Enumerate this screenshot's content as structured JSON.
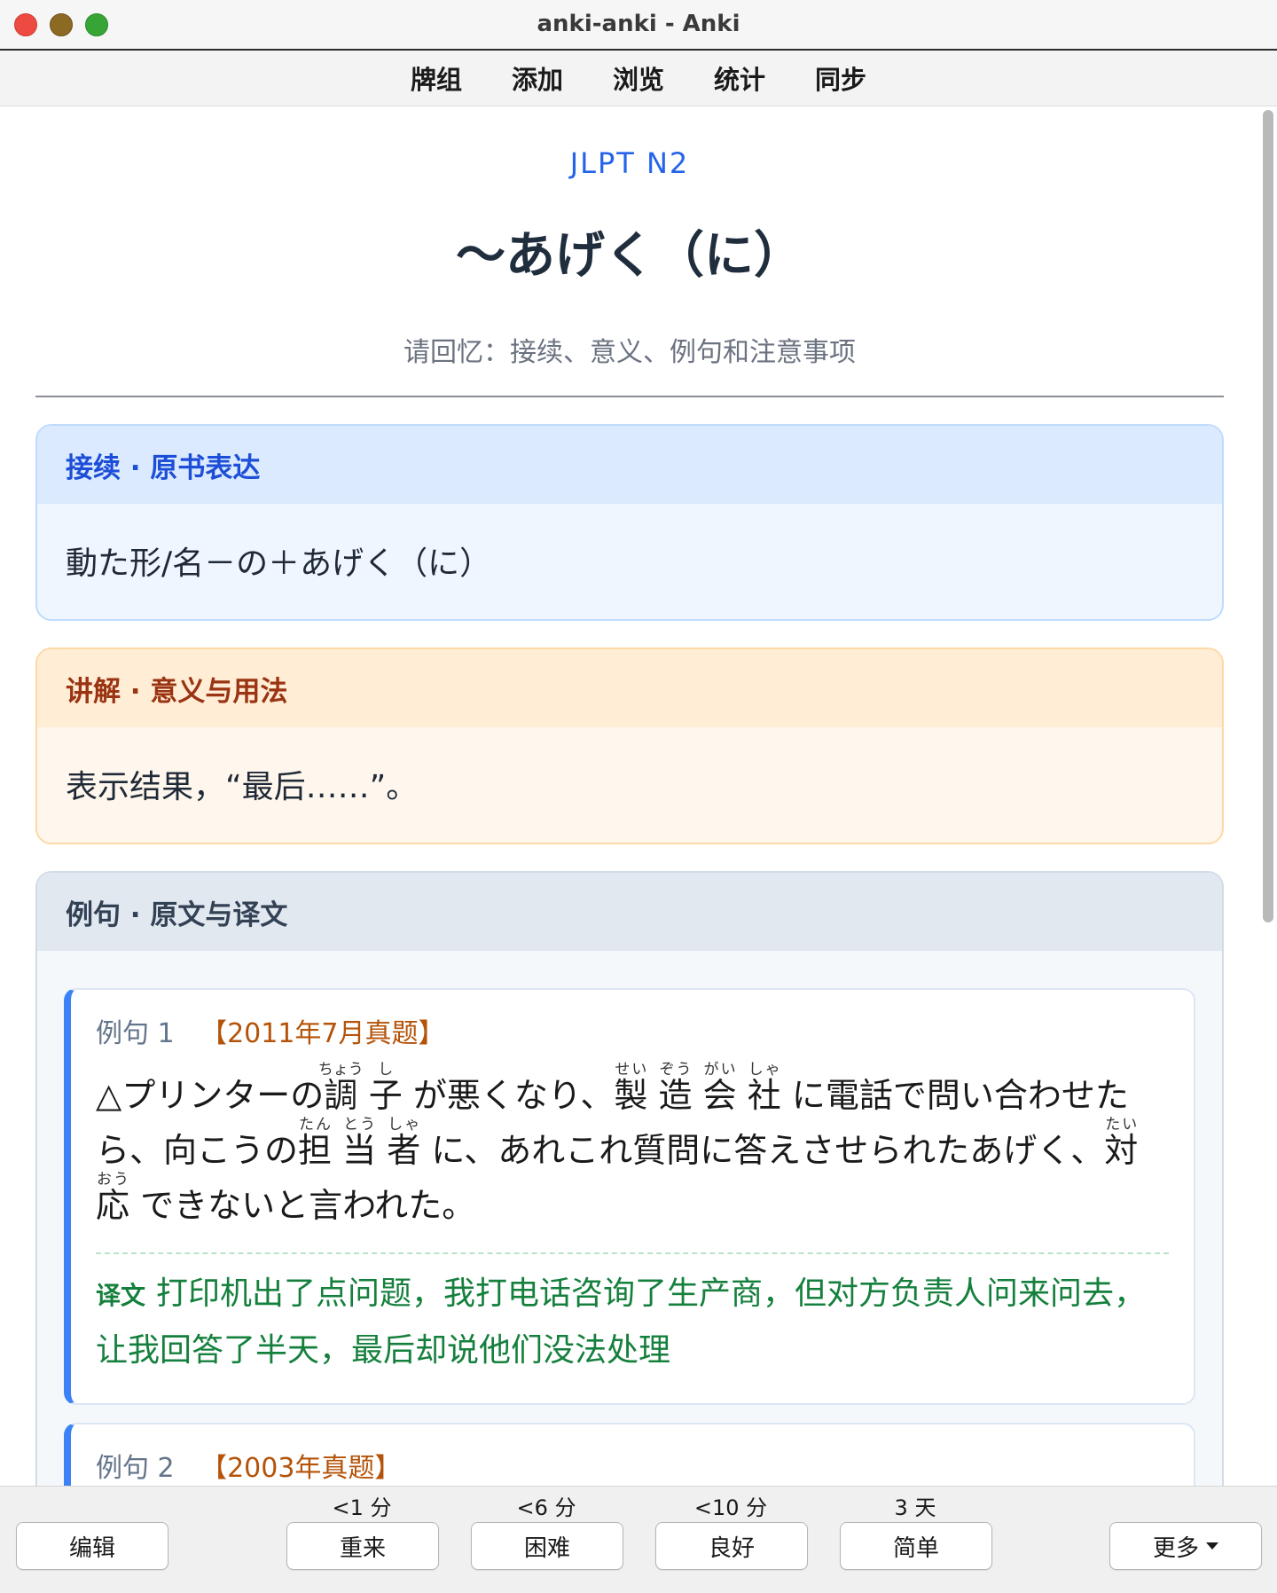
{
  "window": {
    "title": "anki-anki - Anki"
  },
  "toolbar": {
    "items": [
      "牌组",
      "添加",
      "浏览",
      "统计",
      "同步"
    ]
  },
  "card": {
    "level": "JLPT N2",
    "grammar": "〜あげく（に）",
    "prompt": "请回忆：接续、意义、例句和注意事项",
    "connection": {
      "header": "接续 · 原书表达",
      "text": "動た形/名－の＋あげく（に）"
    },
    "explanation": {
      "header": "讲解 · 意义与用法",
      "text": "表示结果，“最后……”。"
    },
    "examples": {
      "header": "例句 · 原文与译文",
      "items": [
        {
          "label": "例句 1",
          "source": "【2011年7月真题】",
          "jp": {
            "p1": "△プリンターの",
            "r1_kanji": "調",
            "r1_reading": "ちょう",
            "r2_kanji": "子",
            "r2_reading": "し",
            "p2": "が悪くなり、",
            "r3_kanji": "製",
            "r3_reading": "せい",
            "r4_kanji": "造",
            "r4_reading": "ぞう",
            "r5_kanji": "会",
            "r5_reading": "がい",
            "r6_kanji": "社",
            "r6_reading": "しゃ",
            "p3": "に電話で問い合わせたら、向こうの",
            "r7_kanji": "担",
            "r7_reading": "たん",
            "r8_kanji": "当",
            "r8_reading": "とう",
            "r9_kanji": "者",
            "r9_reading": "しゃ",
            "p4": "に、あれこれ質問に答えさせられたあげく、",
            "r10_kanji": "対",
            "r10_reading": "たい",
            "r11_kanji": "応",
            "r11_reading": "おう",
            "p5": "できないと言われた。"
          },
          "translation_label": "译文",
          "translation": "打印机出了点问题，我打电话咨询了生产商，但对方负责人问来问去，让我回答了半天，最后却说他们没法处理"
        },
        {
          "label": "例句 2",
          "source": "【2003年真题】"
        }
      ]
    }
  },
  "answer_bar": {
    "edit": "编辑",
    "more": "更多",
    "buttons": [
      {
        "label": "重来",
        "interval": "<1 分"
      },
      {
        "label": "困难",
        "interval": "<6 分"
      },
      {
        "label": "良好",
        "interval": "<10 分"
      },
      {
        "label": "简单",
        "interval": "3 天"
      }
    ]
  },
  "colors": {
    "accent_blue": "#2563eb",
    "section_orange": "#9a3412",
    "translation_green": "#15803d",
    "source_amber": "#b45309"
  }
}
